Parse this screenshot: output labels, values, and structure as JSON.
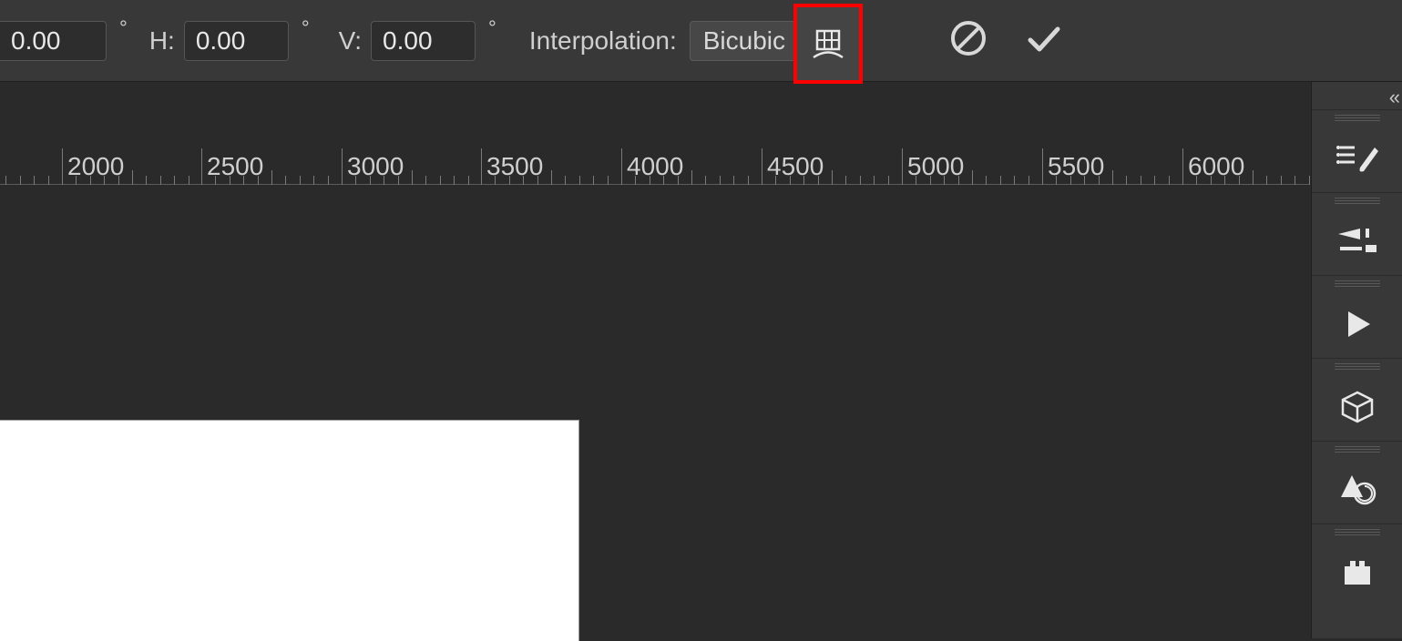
{
  "toolbar": {
    "rotate": {
      "value": "0.00"
    },
    "h": {
      "label": "H:",
      "value": "0.00"
    },
    "v": {
      "label": "V:",
      "value": "0.00"
    },
    "degree_symbol": "°",
    "interpolation": {
      "label": "Interpolation:",
      "value": "Bicubic"
    },
    "warp_icon": "warp-icon",
    "cancel_icon": "cancel-icon",
    "commit_icon": "commit-icon"
  },
  "ruler": {
    "ticks": [
      {
        "value": 2000,
        "pos": 68
      },
      {
        "value": 2500,
        "pos": 221
      },
      {
        "value": 3000,
        "pos": 375
      },
      {
        "value": 3500,
        "pos": 528
      },
      {
        "value": 4000,
        "pos": 682
      },
      {
        "value": 4500,
        "pos": 836
      },
      {
        "value": 5000,
        "pos": 990
      },
      {
        "value": 5500,
        "pos": 1144
      },
      {
        "value": 6000,
        "pos": 1298
      }
    ],
    "minor_per_major": 10,
    "major_spacing": 154
  },
  "right_rail": {
    "collapse_glyph": "«",
    "panels": [
      {
        "name": "brushes-panel-icon"
      },
      {
        "name": "brush-settings-panel-icon"
      },
      {
        "name": "actions-panel-icon"
      },
      {
        "name": "3d-panel-icon"
      },
      {
        "name": "shape-history-panel-icon"
      },
      {
        "name": "plugin-panel-icon"
      }
    ]
  },
  "colors": {
    "bg": "#2a2a2a",
    "panel": "#383838",
    "accent": "#ff0000",
    "text": "#cfcfcf"
  }
}
